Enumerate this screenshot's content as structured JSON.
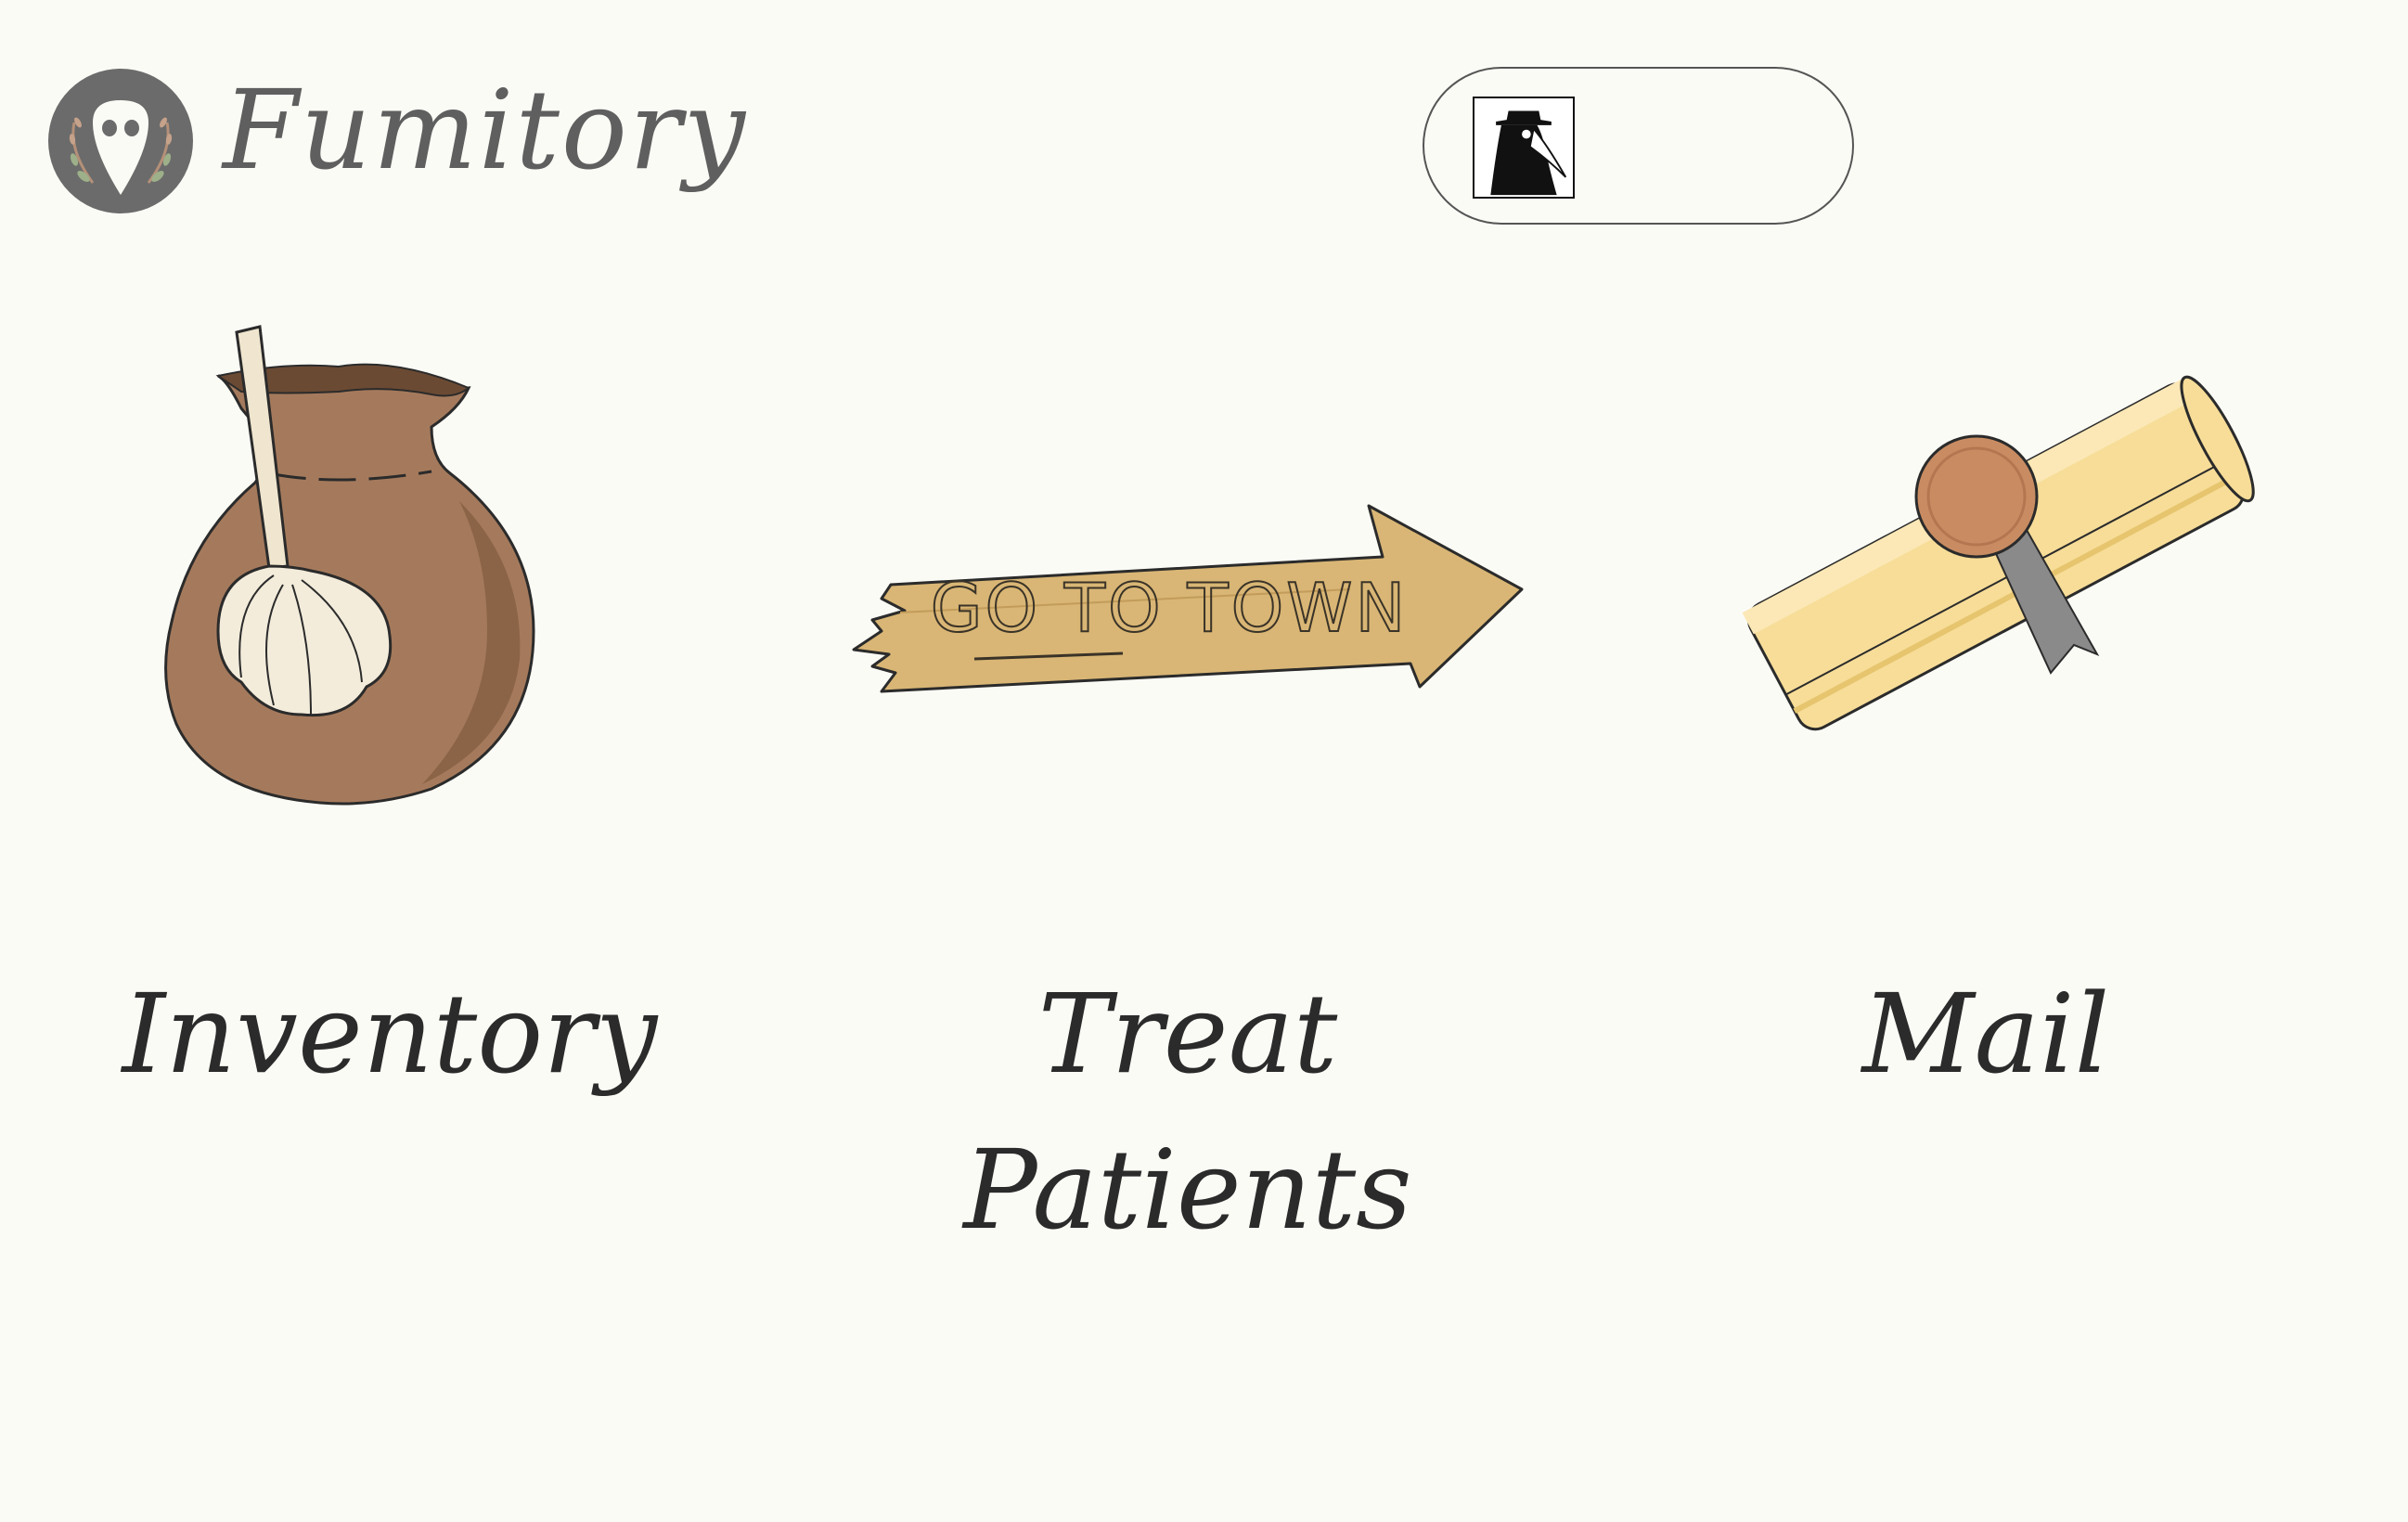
{
  "header": {
    "app_name": "Fumitory",
    "logo_icon": "plague-doctor-mask-icon",
    "profile_avatar_icon": "plague-doctor-avatar-icon"
  },
  "menu": {
    "items": [
      {
        "id": "inventory",
        "label": "Inventory",
        "icon": "garlic-sack-icon"
      },
      {
        "id": "treat",
        "label": "Treat\nPatients",
        "icon": "signpost-arrow-icon",
        "sign_text": "GO TO TOWN"
      },
      {
        "id": "mail",
        "label": "Mail",
        "icon": "sealed-scroll-icon"
      }
    ]
  },
  "colors": {
    "background": "#fbfbf6",
    "text": "#2b2b2b",
    "title": "#5f5f5f",
    "sack": "#a57a5c",
    "sign": "#d9b675",
    "scroll": "#f7dd98",
    "seal": "#c98c62"
  }
}
